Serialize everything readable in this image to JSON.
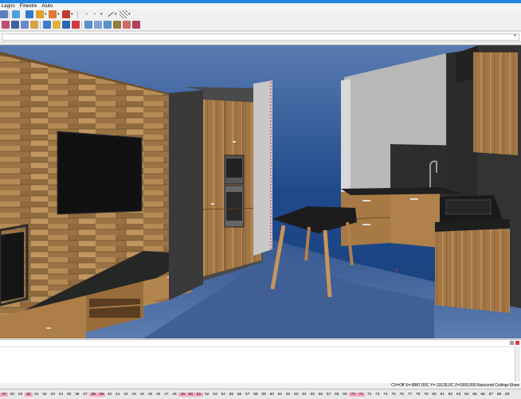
{
  "menu": {
    "items": [
      "Legno",
      "Finestre",
      "Aiuto"
    ]
  },
  "status": {
    "coords": "CV=Off X=-8987,00C Y=-13135,0C Z=1000,000 Nascondi Ceiling+Show"
  },
  "ruler": {
    "numbers": [
      "27",
      "28",
      "29",
      "30",
      "31",
      "32",
      "33",
      "34",
      "35",
      "36",
      "37",
      "38",
      "39",
      "40",
      "41",
      "42",
      "43",
      "44",
      "45",
      "46",
      "47",
      "48",
      "49",
      "50",
      "51",
      "52",
      "53",
      "54",
      "55",
      "56",
      "57",
      "58",
      "59",
      "60",
      "61",
      "62",
      "63",
      "64",
      "65",
      "66",
      "67",
      "68",
      "69",
      "70",
      "71",
      "72",
      "73",
      "74",
      "75",
      "76",
      "77",
      "78",
      "79",
      "80",
      "81",
      "82",
      "83",
      "84",
      "85",
      "86",
      "87",
      "88",
      "89"
    ],
    "highlighted": [
      "27",
      "30",
      "38",
      "39",
      "49",
      "50",
      "51",
      "70",
      "71"
    ]
  },
  "colors": {
    "accent": "#1e88e5",
    "highlight": "#f4a7c3",
    "sky": "#1e4a8c",
    "floor": "#3f5f95",
    "wood": "#a57a49"
  }
}
